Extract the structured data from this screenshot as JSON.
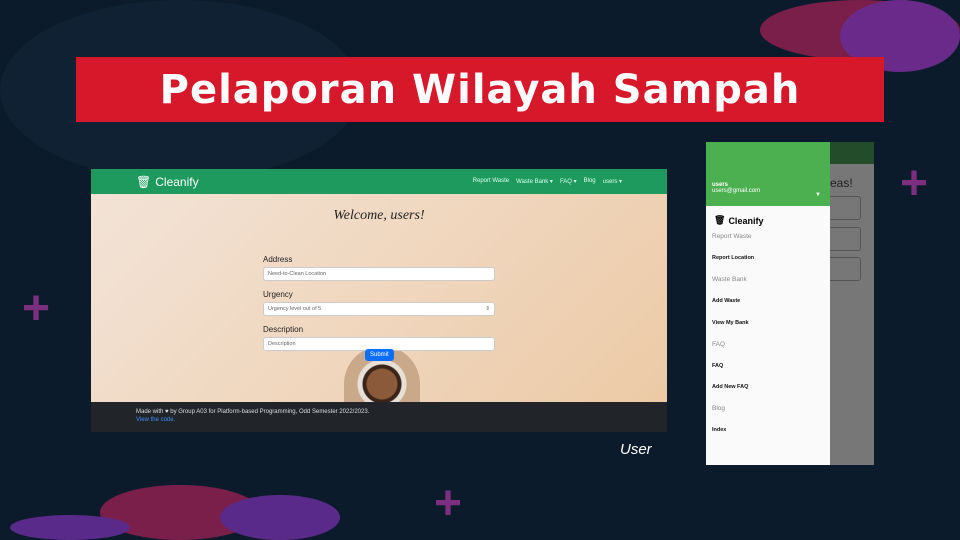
{
  "title": "Pelaporan Wilayah Sampah",
  "caption": "User",
  "web": {
    "brand": "Cleanify",
    "nav": [
      {
        "icon": "megaphone-icon",
        "label": "Report Waste"
      },
      {
        "icon": "bank-icon",
        "label": "Waste Bank ▾"
      },
      {
        "icon": "question-icon",
        "label": "FAQ ▾"
      },
      {
        "icon": "blog-icon",
        "label": "Blog"
      },
      {
        "icon": "user-icon",
        "label": "users ▾"
      }
    ],
    "welcome": "Welcome, users!",
    "address_label": "Address",
    "address_placeholder": "Need-to-Clean Location",
    "urgency_label": "Urgency",
    "urgency_placeholder": "Urgency level out of 5",
    "description_label": "Description",
    "description_placeholder": "Description",
    "submit": "Submit",
    "footer_text": "Made with ♥ by Group A03 for Platform-based Programming, Odd Semester 2022/2023.",
    "footer_link": "View the code."
  },
  "mobile": {
    "username": "users",
    "email": "users@gmail.com",
    "brand": "Cleanify",
    "behind_title": "Areas!",
    "items": [
      {
        "label": "Report Waste",
        "type": "sec"
      },
      {
        "label": "Report Location",
        "type": "sub"
      },
      {
        "label": "Waste Bank",
        "type": "sec"
      },
      {
        "label": "Add Waste",
        "type": "sub"
      },
      {
        "label": "View My Bank",
        "type": "sub"
      },
      {
        "label": "FAQ",
        "type": "sec"
      },
      {
        "label": "FAQ",
        "type": "sub"
      },
      {
        "label": "Add New FAQ",
        "type": "sub"
      },
      {
        "label": "Blog",
        "type": "sec"
      },
      {
        "label": "Index",
        "type": "sub"
      }
    ]
  }
}
